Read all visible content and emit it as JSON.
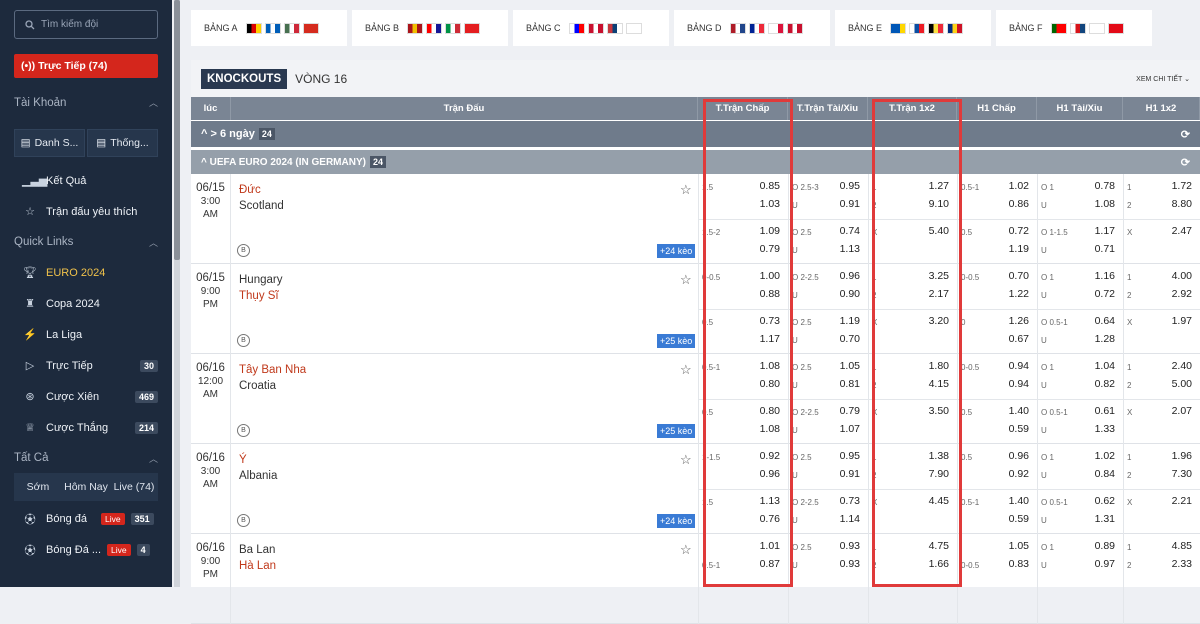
{
  "sidebar": {
    "search_placeholder": "Tìm kiếm đội",
    "live_button": "(•)) Trực Tiếp (74)",
    "tai_khoan": "Tài Khoản",
    "danh_sach": "Danh S...",
    "thong_ke": "Thống...",
    "ket_qua": "Kết Quả",
    "yeu_thich": "Trận đấu yêu thích",
    "quick_links": "Quick Links",
    "euro": "EURO 2024",
    "copa": "Copa 2024",
    "laliga": "La Liga",
    "truc_tiep": "Trực Tiếp",
    "truc_tiep_count": "30",
    "cuoc_xien": "Cược Xiên",
    "cuoc_xien_count": "469",
    "cuoc_thang": "Cược Thắng",
    "cuoc_thang_count": "214",
    "tat_ca": "Tất Cả",
    "som": "Sớm",
    "hom_nay": "Hôm Nay",
    "live74": "Live (74)",
    "bong_da": "Bóng đá",
    "bong_da_live": "Live",
    "bong_da_count": "351",
    "bong_da2": "Bóng Đá ...",
    "bong_da2_live": "Live",
    "bong_da2_count": "4"
  },
  "groups": [
    {
      "label": "BẢNG A",
      "flags": [
        [
          "#000",
          "#dd0000",
          "#ffce00"
        ],
        [
          "#005eb8",
          "#fff",
          "#005eb8"
        ],
        [
          "#477050",
          "#fff",
          "#ce2939"
        ],
        [
          "#d52b1e",
          "#d52b1e",
          "#d52b1e"
        ]
      ]
    },
    {
      "label": "BẢNG B",
      "flags": [
        [
          "#aa151b",
          "#f1bf00",
          "#aa151b"
        ],
        [
          "#ff0000",
          "#fff",
          "#171796"
        ],
        [
          "#009246",
          "#fff",
          "#ce2b37"
        ],
        [
          "#e41e20",
          "#e41e20",
          "#e41e20"
        ]
      ]
    },
    {
      "label": "BẢNG C",
      "flags": [
        [
          "#fff",
          "#0000ff",
          "#ff0000"
        ],
        [
          "#c8102e",
          "#fff",
          "#c8102e"
        ],
        [
          "#c6363c",
          "#0c4076",
          "#fff"
        ],
        [
          "#fff",
          "#fff",
          "#fff"
        ]
      ]
    },
    {
      "label": "BẢNG D",
      "flags": [
        [
          "#ae1c28",
          "#fff",
          "#21468b"
        ],
        [
          "#002395",
          "#fff",
          "#ed2939"
        ],
        [
          "#fff",
          "#fff",
          "#dc143c"
        ],
        [
          "#c8102e",
          "#fff",
          "#c8102e"
        ]
      ]
    },
    {
      "label": "BẢNG E",
      "flags": [
        [
          "#0057b7",
          "#0057b7",
          "#ffd700"
        ],
        [
          "#fff",
          "#0b4ea2",
          "#ee1c25"
        ],
        [
          "#000",
          "#fae042",
          "#ed2939"
        ],
        [
          "#002b7f",
          "#fcd116",
          "#ce1126"
        ]
      ]
    },
    {
      "label": "BẢNG F",
      "flags": [
        [
          "#006600",
          "#ff0000",
          "#ff0000"
        ],
        [
          "#fff",
          "#d7141a",
          "#11457e"
        ],
        [
          "#fff",
          "#fff",
          "#fff"
        ],
        [
          "#e30a17",
          "#e30a17",
          "#e30a17"
        ]
      ]
    }
  ],
  "header": {
    "knockouts": "KNOCKOUTS",
    "vong": "VÒNG 16",
    "xem": "XEM CHI TIẾT ⌄"
  },
  "columns": [
    "lúc",
    "Trận Đấu",
    "T.Trận Chấp",
    "T.Trận Tài/Xỉu",
    "T.Trận 1x2",
    "H1 Chấp",
    "H1 Tài/Xỉu",
    "H1 1x2"
  ],
  "bar1": {
    "label": "^ > 6 ngày",
    "count": "24"
  },
  "bar2": {
    "label": "^ UEFA EURO 2024 (IN GERMANY)",
    "count": "24"
  },
  "matches": [
    {
      "date": "06/15",
      "time": "3:00",
      "ampm": "AM",
      "home": "Đức",
      "away": "Scotland",
      "homeRed": true,
      "awayRed": false,
      "keo": "+24 kèo",
      "rows": [
        {
          "chap": [
            "1.5",
            "0.85",
            "",
            "1.03"
          ],
          "tx": [
            "O 2.5-3",
            "0.95",
            "U",
            "0.91"
          ],
          "x12": [
            "1",
            "1.27",
            "2",
            "9.10"
          ],
          "h1c": [
            "0.5-1",
            "1.02",
            "",
            "0.86"
          ],
          "h1t": [
            "O 1",
            "0.78",
            "U",
            "1.08"
          ],
          "h1x": [
            "1",
            "1.72",
            "2",
            "8.80"
          ]
        },
        {
          "chap": [
            "1.5-2",
            "1.09",
            "",
            "0.79"
          ],
          "tx": [
            "O 2.5",
            "0.74",
            "U",
            "1.13"
          ],
          "x12": [
            "X",
            "5.40",
            "",
            ""
          ],
          "h1c": [
            "0.5",
            "0.72",
            "",
            "1.19"
          ],
          "h1t": [
            "O 1-1.5",
            "1.17",
            "U",
            "0.71"
          ],
          "h1x": [
            "X",
            "2.47",
            "",
            ""
          ]
        }
      ]
    },
    {
      "date": "06/15",
      "time": "9:00",
      "ampm": "PM",
      "home": "Hungary",
      "away": "Thụy Sĩ",
      "homeRed": false,
      "awayRed": true,
      "keo": "+25 kèo",
      "rows": [
        {
          "chap": [
            "0-0.5",
            "1.00",
            "",
            "0.88"
          ],
          "tx": [
            "O 2-2.5",
            "0.96",
            "U",
            "0.90"
          ],
          "x12": [
            "1",
            "3.25",
            "2",
            "2.17"
          ],
          "h1c": [
            "0-0.5",
            "0.70",
            "",
            "1.22"
          ],
          "h1t": [
            "O 1",
            "1.16",
            "U",
            "0.72"
          ],
          "h1x": [
            "1",
            "4.00",
            "2",
            "2.92"
          ]
        },
        {
          "chap": [
            "0.5",
            "0.73",
            "",
            "1.17"
          ],
          "tx": [
            "O 2.5",
            "1.19",
            "U",
            "0.70"
          ],
          "x12": [
            "X",
            "3.20",
            "",
            ""
          ],
          "h1c": [
            "0",
            "1.26",
            "",
            "0.67"
          ],
          "h1t": [
            "O 0.5-1",
            "0.64",
            "U",
            "1.28"
          ],
          "h1x": [
            "X",
            "1.97",
            "",
            ""
          ]
        }
      ]
    },
    {
      "date": "06/16",
      "time": "12:00",
      "ampm": "AM",
      "home": "Tây Ban Nha",
      "away": "Croatia",
      "homeRed": true,
      "awayRed": false,
      "keo": "+25 kèo",
      "rows": [
        {
          "chap": [
            "0.5-1",
            "1.08",
            "",
            "0.80"
          ],
          "tx": [
            "O 2.5",
            "1.05",
            "U",
            "0.81"
          ],
          "x12": [
            "1",
            "1.80",
            "2",
            "4.15"
          ],
          "h1c": [
            "0-0.5",
            "0.94",
            "",
            "0.94"
          ],
          "h1t": [
            "O 1",
            "1.04",
            "U",
            "0.82"
          ],
          "h1x": [
            "1",
            "2.40",
            "2",
            "5.00"
          ]
        },
        {
          "chap": [
            "0.5",
            "0.80",
            "",
            "1.08"
          ],
          "tx": [
            "O 2-2.5",
            "0.79",
            "U",
            "1.07"
          ],
          "x12": [
            "X",
            "3.50",
            "",
            ""
          ],
          "h1c": [
            "0.5",
            "1.40",
            "",
            "0.59"
          ],
          "h1t": [
            "O 0.5-1",
            "0.61",
            "U",
            "1.33"
          ],
          "h1x": [
            "X",
            "2.07",
            "",
            ""
          ]
        }
      ]
    },
    {
      "date": "06/16",
      "time": "3:00",
      "ampm": "AM",
      "home": "Ý",
      "away": "Albania",
      "homeRed": true,
      "awayRed": false,
      "keo": "+24 kèo",
      "rows": [
        {
          "chap": [
            "1-1.5",
            "0.92",
            "",
            "0.96"
          ],
          "tx": [
            "O 2.5",
            "0.95",
            "U",
            "0.91"
          ],
          "x12": [
            "1",
            "1.38",
            "2",
            "7.90"
          ],
          "h1c": [
            "0.5",
            "0.96",
            "",
            "0.92"
          ],
          "h1t": [
            "O 1",
            "1.02",
            "U",
            "0.84"
          ],
          "h1x": [
            "1",
            "1.96",
            "2",
            "7.30"
          ]
        },
        {
          "chap": [
            "1.5",
            "1.13",
            "",
            "0.76"
          ],
          "tx": [
            "O 2-2.5",
            "0.73",
            "U",
            "1.14"
          ],
          "x12": [
            "X",
            "4.45",
            "",
            ""
          ],
          "h1c": [
            "0.5-1",
            "1.40",
            "",
            "0.59"
          ],
          "h1t": [
            "O 0.5-1",
            "0.62",
            "U",
            "1.31"
          ],
          "h1x": [
            "X",
            "2.21",
            "",
            ""
          ]
        }
      ]
    },
    {
      "date": "06/16",
      "time": "9:00",
      "ampm": "PM",
      "home": "Ba Lan",
      "away": "Hà Lan",
      "homeRed": false,
      "awayRed": true,
      "keo": "",
      "rows": [
        {
          "chap": [
            "",
            "1.01",
            "0.5-1",
            "0.87"
          ],
          "tx": [
            "O 2.5",
            "0.93",
            "U",
            "0.93"
          ],
          "x12": [
            "1",
            "4.75",
            "2",
            "1.66"
          ],
          "h1c": [
            "",
            "1.05",
            "0-0.5",
            "0.83"
          ],
          "h1t": [
            "O 1",
            "0.89",
            "U",
            "0.97"
          ],
          "h1x": [
            "1",
            "4.85",
            "2",
            "2.33"
          ]
        }
      ]
    }
  ]
}
